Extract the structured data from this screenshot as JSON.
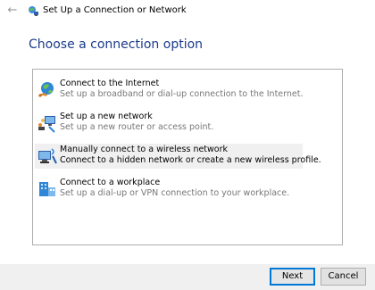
{
  "window": {
    "back_icon": "back-arrow-icon",
    "app_icon": "network-setup-icon",
    "title": "Set Up a Connection or Network"
  },
  "main": {
    "heading": "Choose a connection option",
    "options": [
      {
        "title": "Connect to the Internet",
        "description": "Set up a broadband or dial-up connection to the Internet.",
        "icon": "internet-globe-icon",
        "selected": false
      },
      {
        "title": "Set up a new network",
        "description": "Set up a new router or access point.",
        "icon": "new-network-icon",
        "selected": false
      },
      {
        "title": "Manually connect to a wireless network",
        "description": "Connect to a hidden network or create a new wireless profile.",
        "icon": "wireless-network-icon",
        "selected": true
      },
      {
        "title": "Connect to a workplace",
        "description": "Set up a dial-up or VPN connection to your workplace.",
        "icon": "workplace-vpn-icon",
        "selected": false
      }
    ]
  },
  "footer": {
    "next_label": "Next",
    "cancel_label": "Cancel"
  },
  "colors": {
    "heading": "#1b3b8a",
    "accent_border": "#0078d7",
    "selected_row": "#f0f0f0",
    "footer_bg": "#f0f0f0"
  }
}
